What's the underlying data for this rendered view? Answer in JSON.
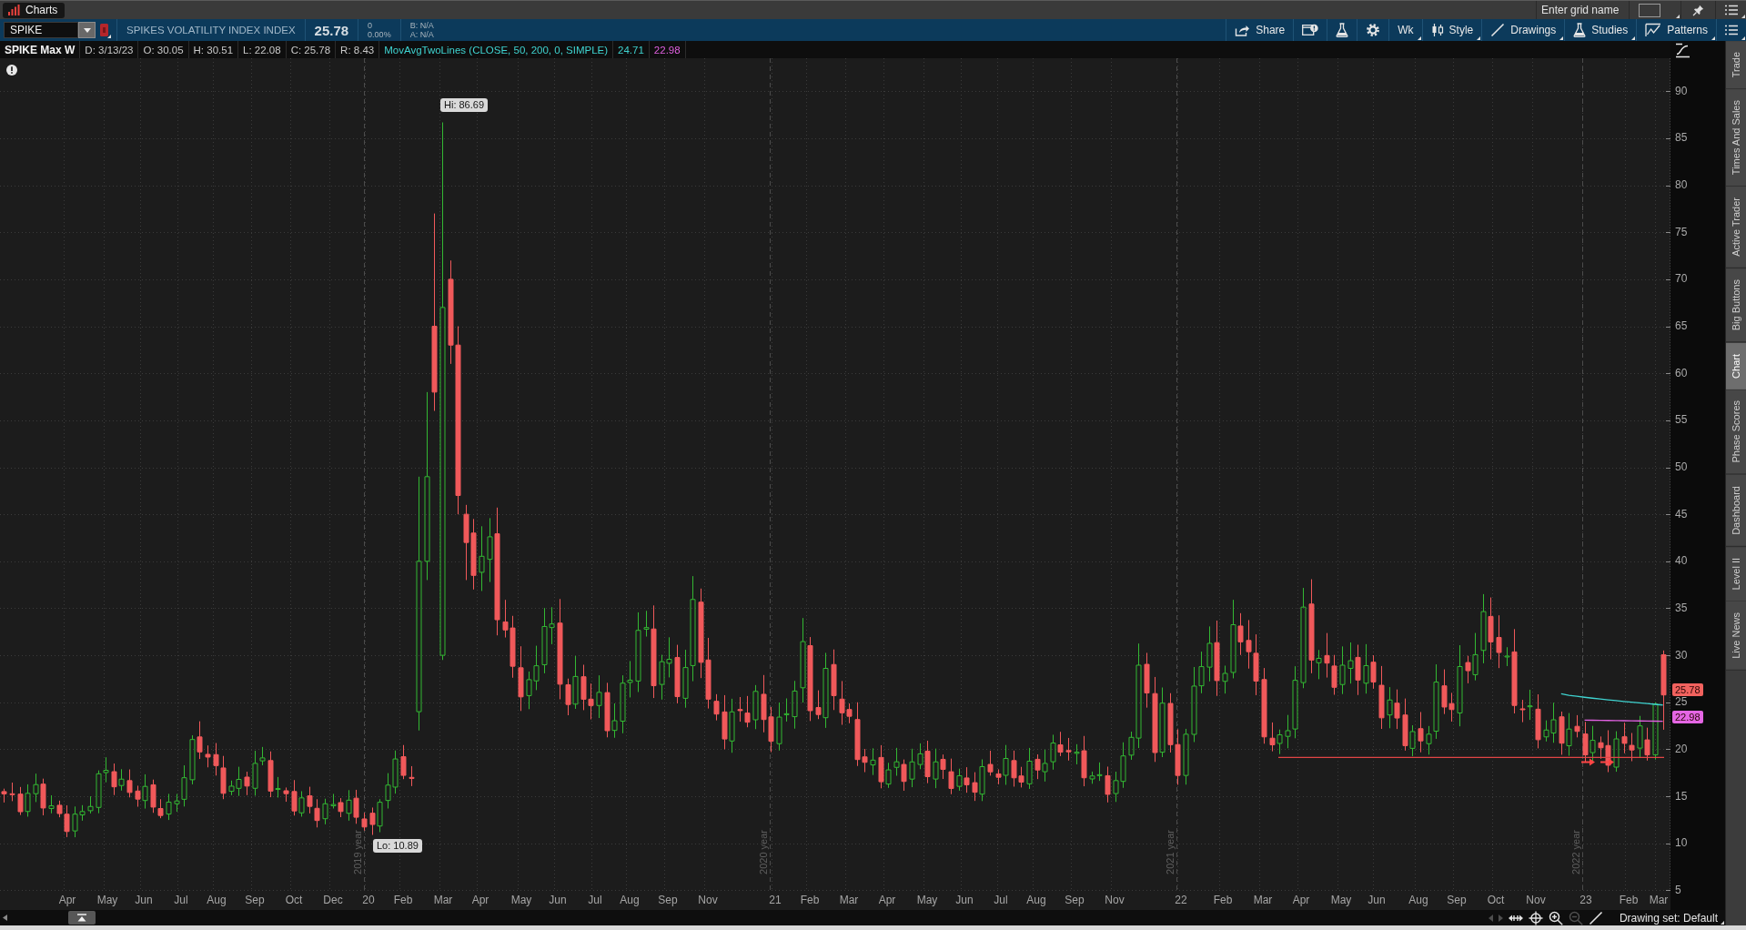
{
  "window": {
    "tab": "Charts",
    "grid_name": {
      "placeholder": "Enter grid name"
    }
  },
  "toolbar": {
    "symbol": "SPIKE",
    "description": "SPIKES VOLATILITY INDEX INDEX",
    "last": "25.78",
    "change": "0",
    "change_percent": "0.00%",
    "bid": "B: N/A",
    "ask": "A: N/A",
    "buttons": [
      {
        "kind": "share",
        "label": "Share",
        "dropdown": false
      },
      {
        "kind": "alerts",
        "dropdown": false
      },
      {
        "kind": "lab",
        "dropdown": false
      },
      {
        "kind": "settings",
        "dropdown": false
      },
      {
        "kind": "text",
        "label": "Wk",
        "dropdown": true
      },
      {
        "kind": "style",
        "label": "Style",
        "dropdown": true
      },
      {
        "kind": "drawings",
        "label": "Drawings",
        "dropdown": true
      },
      {
        "kind": "studies",
        "label": "Studies",
        "dropdown": true
      },
      {
        "kind": "patterns",
        "label": "Patterns",
        "dropdown": true
      },
      {
        "kind": "menu",
        "dropdown": true
      }
    ]
  },
  "header": {
    "title": "SPIKE Max W",
    "fields": [
      "D: 3/13/23",
      "O: 30.05",
      "H: 30.51",
      "L: 22.08",
      "C: 25.78",
      "R: 8.43"
    ],
    "study": "MovAvgTwoLines (CLOSE, 50, 200, 0, SIMPLE)",
    "study_values": [
      {
        "text": "24.71",
        "color": "#3fd3d0"
      },
      {
        "text": "22.98",
        "color": "#e060e0"
      }
    ]
  },
  "chart": {
    "high_label": "Hi: 86.69",
    "low_label": "Lo: 10.89",
    "year_markers": [
      "2019 year",
      "2020 year",
      "2021 year",
      "2022 year"
    ],
    "price_axis": [
      "90",
      "85",
      "80",
      "75",
      "70",
      "65",
      "60",
      "55",
      "50",
      "45",
      "40",
      "35",
      "30",
      "25",
      "20",
      "15",
      "10",
      "5"
    ],
    "price_tags": [
      {
        "text": "25.78",
        "color": "#f2625e"
      },
      {
        "text": "22.98",
        "color": "#e466e4"
      }
    ],
    "time_axis": [
      "Apr",
      "May",
      "Jun",
      "Jul",
      "Aug",
      "Sep",
      "Oct",
      "Dec",
      "20",
      "Feb",
      "Mar",
      "Apr",
      "May",
      "Jun",
      "Jul",
      "Aug",
      "Sep",
      "Nov",
      "21",
      "Feb",
      "Mar",
      "Apr",
      "May",
      "Jun",
      "Jul",
      "Aug",
      "Sep",
      "Nov",
      "22",
      "Feb",
      "Mar",
      "Apr",
      "May",
      "Jun",
      "Aug",
      "Sep",
      "Oct",
      "Nov",
      "23",
      "Feb",
      "Mar"
    ]
  },
  "bottom_bar": {
    "tools": [
      {
        "kind": "prev",
        "disabled": true
      },
      {
        "kind": "next",
        "disabled": true
      },
      {
        "kind": "fit",
        "disabled": false
      },
      {
        "kind": "crosshair",
        "disabled": false
      },
      {
        "kind": "zoom_in",
        "disabled": false
      },
      {
        "kind": "zoom_out",
        "disabled": true
      },
      {
        "kind": "draw",
        "disabled": false
      }
    ],
    "drawing_set": "Drawing set: Default"
  },
  "side_tabs": [
    {
      "label": "Trade",
      "selected": false
    },
    {
      "label": "Times And Sales",
      "selected": false
    },
    {
      "label": "Active Trader",
      "selected": false
    },
    {
      "label": "Big Buttons",
      "selected": false
    },
    {
      "label": "Chart",
      "selected": true
    },
    {
      "label": "Phase Scores",
      "selected": false
    },
    {
      "label": "Dashboard",
      "selected": false
    },
    {
      "label": "Level II",
      "selected": false
    },
    {
      "label": "Live News",
      "selected": false
    }
  ]
}
